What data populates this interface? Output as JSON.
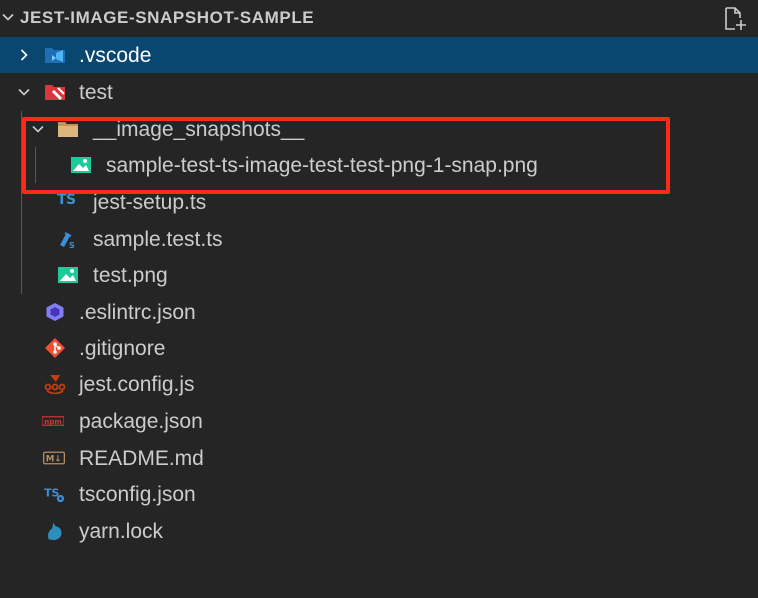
{
  "header": {
    "title": "JEST-IMAGE-SNAPSHOT-SAMPLE",
    "new_file_icon": "new-file-icon",
    "collapse_icon": "chevron-down-icon"
  },
  "tree": {
    "vscode": {
      "label": ".vscode",
      "state": "collapsed",
      "icon": "vscode-folder-icon"
    },
    "test": {
      "label": "test",
      "state": "expanded",
      "icon": "test-folder-icon"
    },
    "image_snapshots": {
      "label": "__image_snapshots__",
      "state": "expanded",
      "icon": "folder-icon"
    },
    "snap_png": {
      "label": "sample-test-ts-image-test-test-png-1-snap.png",
      "icon": "image-icon"
    },
    "jest_setup": {
      "label": "jest-setup.ts",
      "icon": "typescript-icon"
    },
    "sample_test": {
      "label": "sample.test.ts",
      "icon": "test-ts-icon"
    },
    "test_png": {
      "label": "test.png",
      "icon": "image-icon"
    },
    "eslintrc": {
      "label": ".eslintrc.json",
      "icon": "eslint-icon"
    },
    "gitignore": {
      "label": ".gitignore",
      "icon": "git-icon"
    },
    "jest_config": {
      "label": "jest.config.js",
      "icon": "jest-icon"
    },
    "package_json": {
      "label": "package.json",
      "icon": "npm-icon"
    },
    "readme": {
      "label": "README.md",
      "icon": "markdown-icon"
    },
    "tsconfig": {
      "label": "tsconfig.json",
      "icon": "tsconfig-icon"
    },
    "yarn_lock": {
      "label": "yarn.lock",
      "icon": "yarn-icon"
    }
  },
  "icon_text": {
    "ts": "TS",
    "npm": "npm",
    "md": "M↓"
  },
  "colors": {
    "background": "#252526",
    "selection": "#094771",
    "highlight_box": "#ff2a1a",
    "image_icon": "#1ec99a",
    "ts_blue": "#3a8fd8"
  }
}
